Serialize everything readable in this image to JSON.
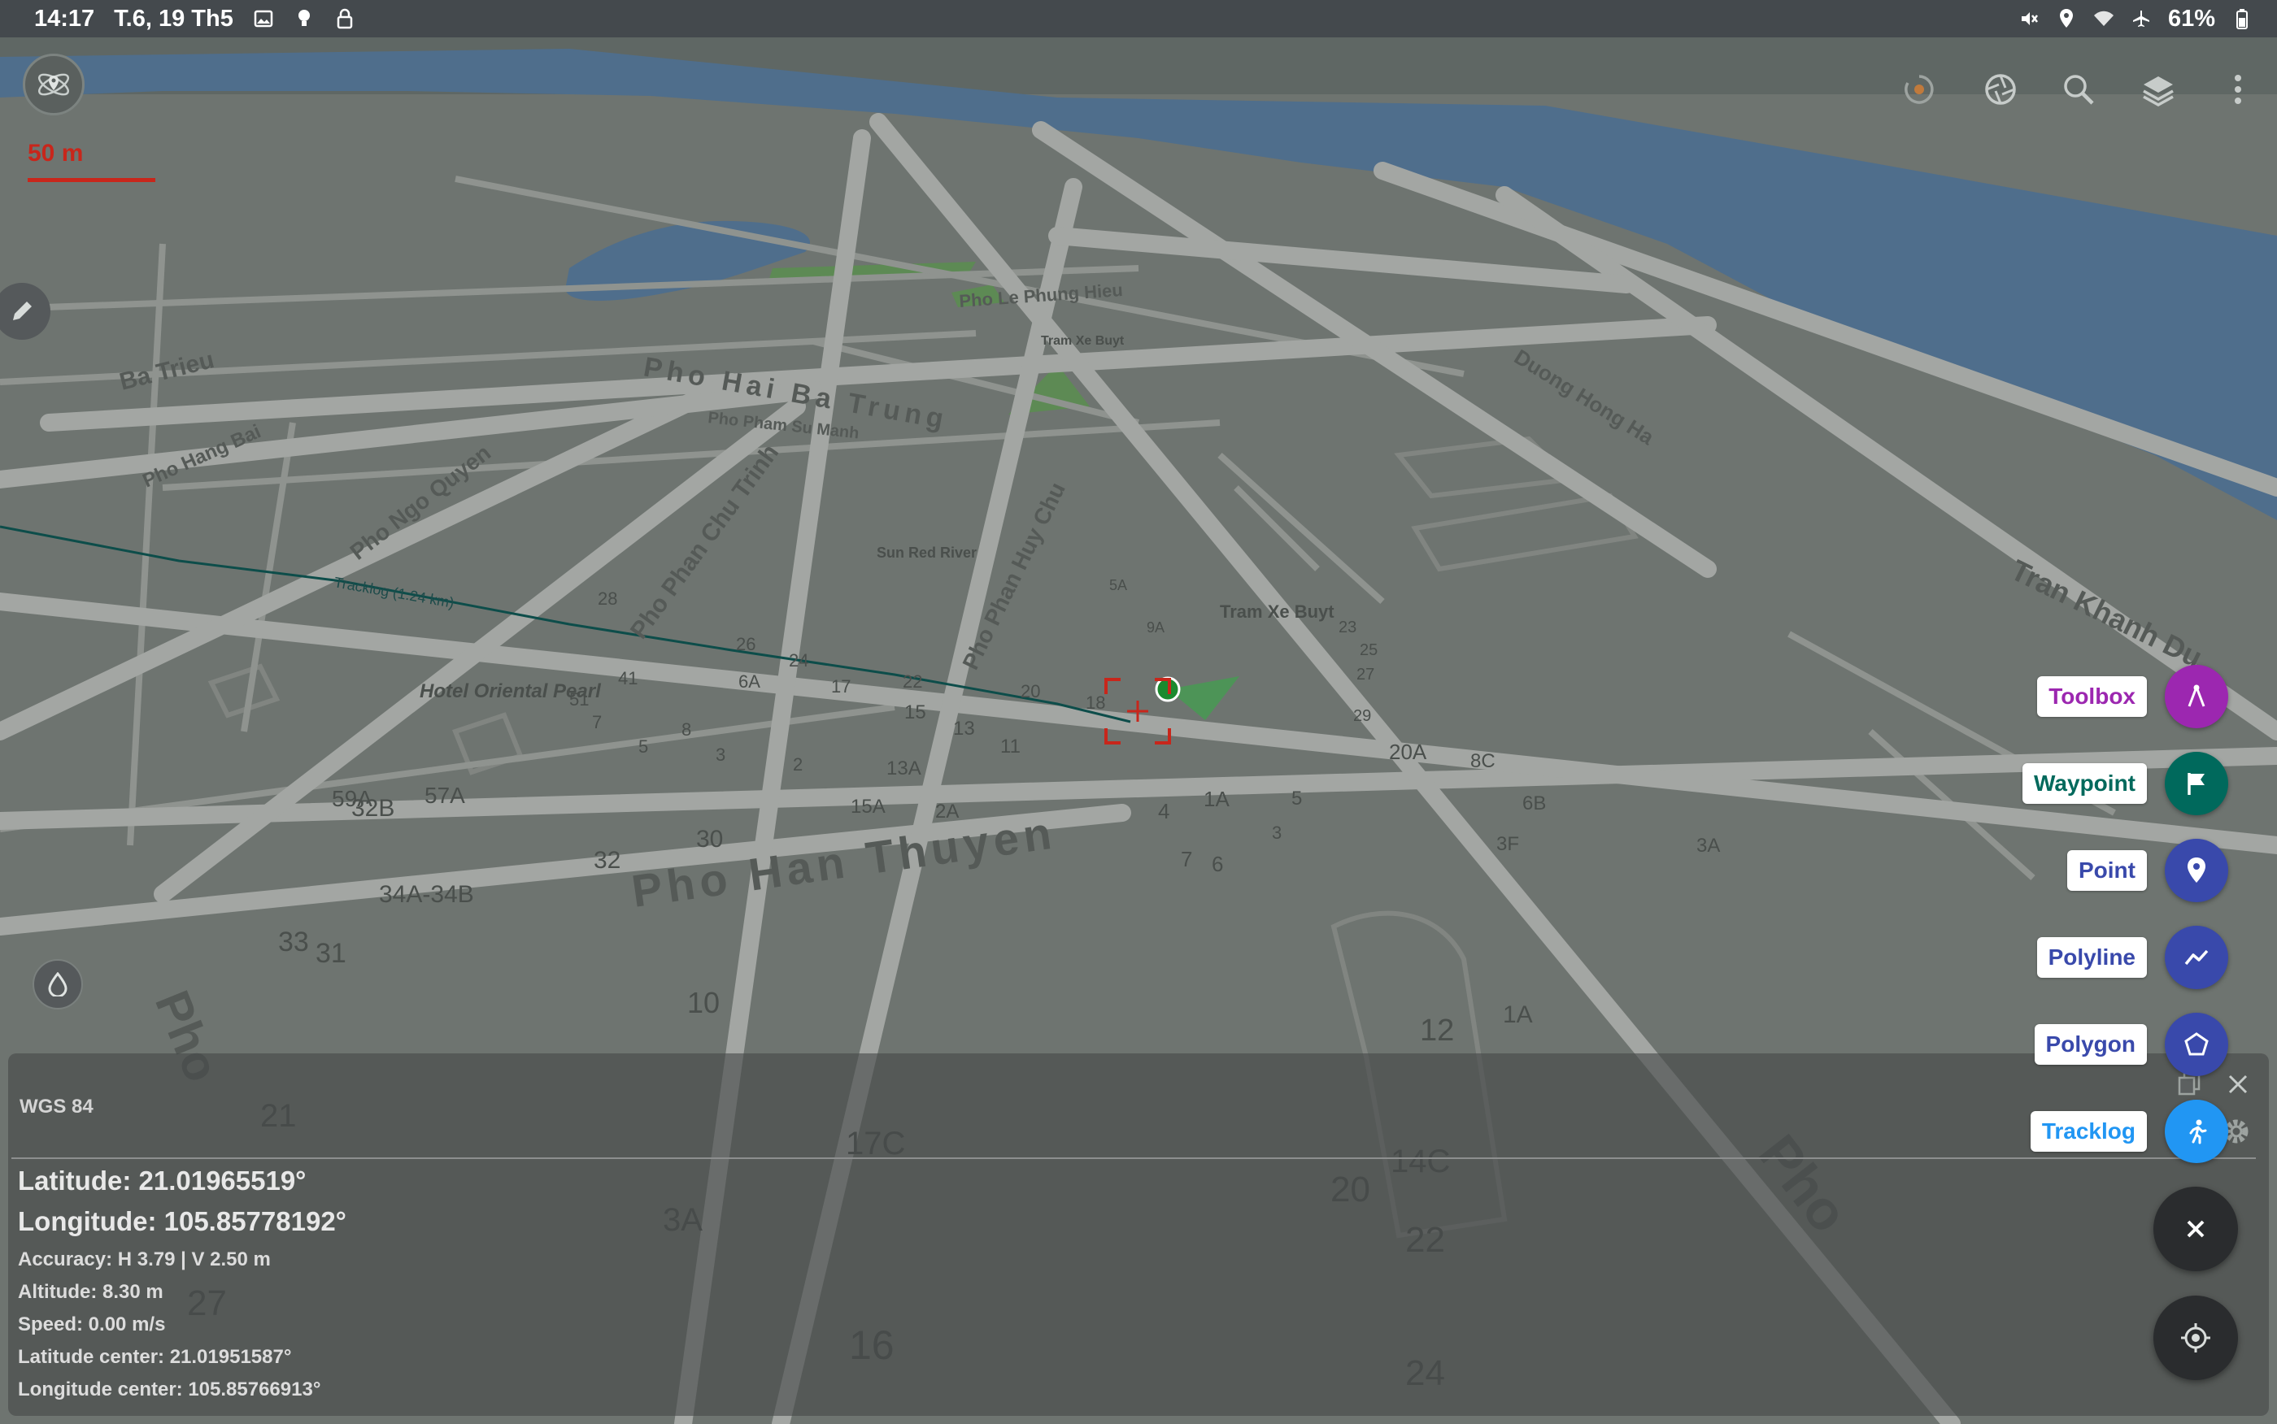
{
  "status_bar": {
    "time": "14:17",
    "date": "T.6, 19 Th5",
    "battery": "61%",
    "left_icons": [
      "image-icon",
      "lightbulb-icon",
      "lock-icon"
    ],
    "right_icons": [
      "mute-icon",
      "location-icon",
      "wifi-icon",
      "airplane-icon",
      "battery-icon"
    ]
  },
  "toolbar": {
    "scale": "50 m",
    "actions": [
      "sync-icon",
      "aperture-icon",
      "search-icon",
      "layers-icon",
      "more-vert-icon"
    ]
  },
  "map": {
    "streets": [
      "Pho Han Thuyen",
      "Pho Hai Ba Trung",
      "Pho Phan Chu Trinh",
      "Pho Phan Huy Chu",
      "Pho Ngo Quyen",
      "Pho Hang Bai",
      "Duong Hong Ha",
      "Tran Khanh Du",
      "Ba Trieu",
      "Pho Le Phung Hieu",
      "Pho Pham Su Manh",
      "Pho"
    ],
    "places": [
      "Tram Xe Buyt",
      "Sun Red River",
      "Hotel Oriental Pearl"
    ],
    "track_label": "Tracklog (1.24 km)",
    "house_numbers": [
      "28",
      "26",
      "24",
      "22",
      "20",
      "18",
      "15",
      "13",
      "11",
      "6A",
      "17",
      "41",
      "51",
      "8",
      "7",
      "5",
      "3",
      "2",
      "13A",
      "15A",
      "2A",
      "4",
      "1A",
      "5",
      "3",
      "7",
      "6",
      "32",
      "30",
      "32B",
      "57A",
      "59A",
      "34A-34B",
      "33",
      "31",
      "20A",
      "8C",
      "6B",
      "3F",
      "3A",
      "10",
      "12",
      "14C",
      "20",
      "22",
      "24",
      "16",
      "21",
      "27",
      "17C",
      "3A",
      "1A",
      "29",
      "27",
      "25",
      "23",
      "9A",
      "5A"
    ]
  },
  "colors": {
    "map_background": "#6e7470",
    "water": "#4f6e8c",
    "road": "#a3a6a3",
    "scale": "#c8261b",
    "toolbox": "#9c27b0",
    "waypoint": "#00695c",
    "point": "#3949ab",
    "polyline": "#3949ab",
    "polygon": "#3949ab",
    "tracklog": "#2196f3"
  },
  "panel": {
    "crs": "WGS 84",
    "latitude": "Latitude: 21.01965519°",
    "longitude": "Longitude: 105.85778192°",
    "accuracy": "Accuracy: H 3.79 | V 2.50 m",
    "altitude": "Altitude: 8.30 m",
    "speed": "Speed: 0.00 m/s",
    "latitude_center": "Latitude center: 21.01951587°",
    "longitude_center": "Longitude center: 105.85766913°"
  },
  "speed_dial": [
    {
      "label": "Toolbox",
      "icon": "compass-icon"
    },
    {
      "label": "Waypoint",
      "icon": "flag-icon"
    },
    {
      "label": "Point",
      "icon": "map-pin-icon"
    },
    {
      "label": "Polyline",
      "icon": "polyline-icon"
    },
    {
      "label": "Polygon",
      "icon": "pentagon-icon"
    },
    {
      "label": "Tracklog",
      "icon": "run-icon"
    }
  ]
}
